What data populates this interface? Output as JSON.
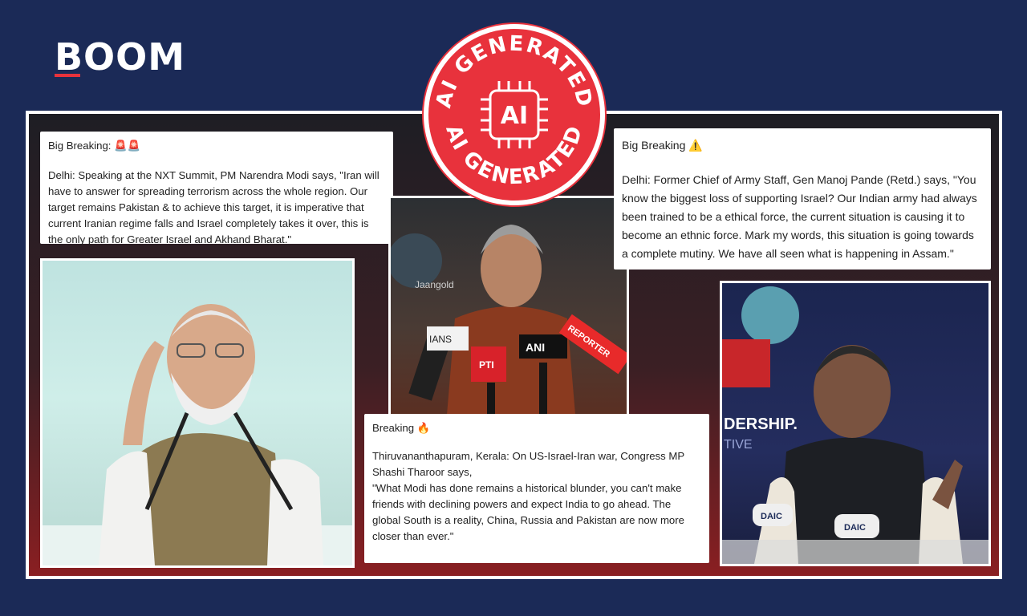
{
  "brand": {
    "name": "BOOM"
  },
  "stamp": {
    "text_top": "AI GENERATED",
    "text_bottom": "AI GENERATED",
    "center": "AI"
  },
  "cards": {
    "modi": {
      "header": "Big Breaking: 🚨🚨",
      "body": "Delhi: Speaking at the NXT Summit, PM Narendra Modi says, \"Iran will have to answer for spreading terrorism across the whole region. Our target remains Pakistan & to achieve this target, it is imperative that current Iranian regime falls and Israel completely takes it over, this is the only path for Greater Israel and Akhand Bharat.\""
    },
    "pande": {
      "header": "Big Breaking ⚠️",
      "body": "Delhi: Former Chief of Army Staff, Gen Manoj Pande (Retd.) says, \"You know the biggest loss of supporting Israel? Our Indian army had always been trained to be a ethical force, the current situation is causing it to become an ethnic force. Mark my words, this situation is going towards a complete mutiny. We have all seen what is happening in Assam.\""
    },
    "tharoor": {
      "header": "Breaking 🔥",
      "line1": "Thiruvananthapuram, Kerala: On US-Israel-Iran war, Congress MP Shashi Tharoor  says,",
      "body": "\"What Modi has done remains a historical blunder, you can't make friends with declining powers and expect India to go ahead. The global South is a reality, China, Russia and Pakistan are now more closer than ever.\""
    }
  },
  "photo_labels": {
    "mic_1": "IANS",
    "mic_2": "PTI",
    "mic_3": "ANI",
    "mic_4": "REPORTER",
    "backdrop": "Jaangold",
    "stage_text": "DERSHIP.",
    "stage_text_2": "TIVE",
    "podium_1": "DAIC",
    "podium_2": "DAIC"
  },
  "colors": {
    "background": "#1b2a57",
    "accent_red": "#e8323c"
  }
}
